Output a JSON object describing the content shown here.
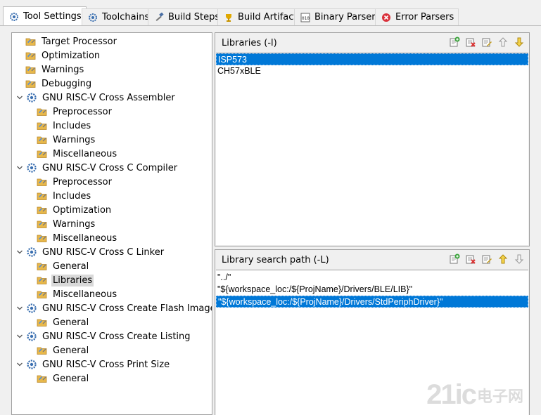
{
  "tabs": [
    {
      "label": "Tool Settings",
      "icon": "gear-icon",
      "active": true
    },
    {
      "label": "Toolchains",
      "icon": "gear-icon",
      "active": false
    },
    {
      "label": "Build Steps",
      "icon": "hammer-icon",
      "active": false
    },
    {
      "label": "Build Artifact",
      "icon": "trophy-icon",
      "active": false
    },
    {
      "label": "Binary Parsers",
      "icon": "binary-icon",
      "active": false
    },
    {
      "label": "Error Parsers",
      "icon": "error-icon",
      "active": false
    }
  ],
  "tree": [
    {
      "label": "Target Processor",
      "level": 1,
      "kind": "folder"
    },
    {
      "label": "Optimization",
      "level": 1,
      "kind": "folder"
    },
    {
      "label": "Warnings",
      "level": 1,
      "kind": "folder"
    },
    {
      "label": "Debugging",
      "level": 1,
      "kind": "folder"
    },
    {
      "label": "GNU RISC-V Cross Assembler",
      "level": 0,
      "kind": "tool"
    },
    {
      "label": "Preprocessor",
      "level": 2,
      "kind": "folder"
    },
    {
      "label": "Includes",
      "level": 2,
      "kind": "folder"
    },
    {
      "label": "Warnings",
      "level": 2,
      "kind": "folder"
    },
    {
      "label": "Miscellaneous",
      "level": 2,
      "kind": "folder"
    },
    {
      "label": "GNU RISC-V Cross C Compiler",
      "level": 0,
      "kind": "tool"
    },
    {
      "label": "Preprocessor",
      "level": 2,
      "kind": "folder"
    },
    {
      "label": "Includes",
      "level": 2,
      "kind": "folder"
    },
    {
      "label": "Optimization",
      "level": 2,
      "kind": "folder"
    },
    {
      "label": "Warnings",
      "level": 2,
      "kind": "folder"
    },
    {
      "label": "Miscellaneous",
      "level": 2,
      "kind": "folder"
    },
    {
      "label": "GNU RISC-V Cross C Linker",
      "level": 0,
      "kind": "tool"
    },
    {
      "label": "General",
      "level": 2,
      "kind": "folder"
    },
    {
      "label": "Libraries",
      "level": 2,
      "kind": "folder",
      "selected": true
    },
    {
      "label": "Miscellaneous",
      "level": 2,
      "kind": "folder"
    },
    {
      "label": "GNU RISC-V Cross Create Flash Image",
      "level": 0,
      "kind": "tool"
    },
    {
      "label": "General",
      "level": 2,
      "kind": "folder"
    },
    {
      "label": "GNU RISC-V Cross Create Listing",
      "level": 0,
      "kind": "tool"
    },
    {
      "label": "General",
      "level": 2,
      "kind": "folder"
    },
    {
      "label": "GNU RISC-V Cross Print Size",
      "level": 0,
      "kind": "tool"
    },
    {
      "label": "General",
      "level": 2,
      "kind": "folder"
    }
  ],
  "libraries": {
    "title": "Libraries (-l)",
    "items": [
      {
        "value": "ISP573",
        "selected": true
      },
      {
        "value": "CH57xBLE",
        "selected": false
      }
    ]
  },
  "search_path": {
    "title": "Library search path (-L)",
    "items": [
      {
        "value": "\"../\"",
        "selected": false
      },
      {
        "value": "\"${workspace_loc:/${ProjName}/Drivers/BLE/LIB}\"",
        "selected": false
      },
      {
        "value": "\"${workspace_loc:/${ProjName}/Drivers/StdPeriphDriver}\"",
        "selected": true
      }
    ]
  },
  "toolbar_icons": [
    "add-icon",
    "delete-icon",
    "edit-icon",
    "move-up-icon",
    "move-down-icon"
  ],
  "watermark": {
    "num": "21ic",
    "cn": "电子网"
  },
  "colors": {
    "selection": "#0078d7",
    "folder": "#e8b84a",
    "gear": "#3a6fb0"
  }
}
